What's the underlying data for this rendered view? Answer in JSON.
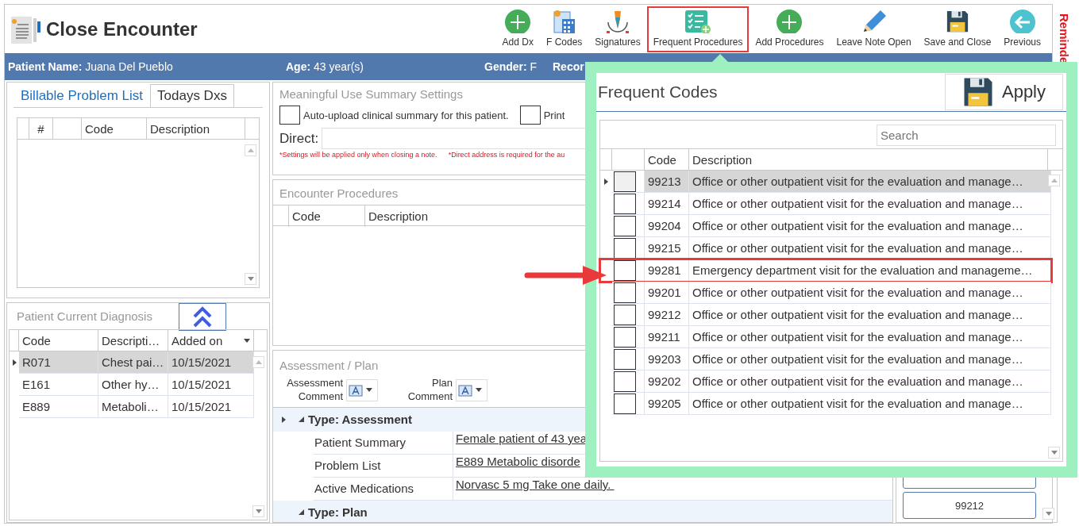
{
  "window": {
    "title": "Close Encounter",
    "side_tab": "Reminde"
  },
  "toolbar": [
    {
      "label": "Add Dx",
      "kind": "plus",
      "highlighted": false
    },
    {
      "label": "F Codes",
      "kind": "calculator",
      "highlighted": false
    },
    {
      "label": "Signatures",
      "kind": "pen",
      "highlighted": false
    },
    {
      "label": "Frequent Procedures",
      "kind": "checklist",
      "highlighted": true
    },
    {
      "label": "Add Procedures",
      "kind": "plus",
      "highlighted": false
    },
    {
      "label": "Leave Note Open",
      "kind": "pencil",
      "highlighted": false
    },
    {
      "label": "Save and Close",
      "kind": "floppy",
      "highlighted": false
    },
    {
      "label": "Previous",
      "kind": "back",
      "highlighted": false
    }
  ],
  "patient_bar": [
    {
      "label": "Patient Name:",
      "value": "Juana Del Pueblo"
    },
    {
      "label": "Age:",
      "value": "43 year(s)"
    },
    {
      "label": "Gender:",
      "value": "F"
    },
    {
      "label": "Recor"
    }
  ],
  "problem_tabs": [
    {
      "label": "Billable Problem List",
      "selected": true
    },
    {
      "label": "Todays Dxs",
      "selected": false
    }
  ],
  "problem_grid": {
    "columns": [
      "#",
      "Code",
      "Description"
    ]
  },
  "current_diagnosis": {
    "title": "Patient Current Diagnosis",
    "columns": [
      "Code",
      "Descripti…",
      "Added on"
    ],
    "rows": [
      {
        "code": "R071",
        "description": "Chest pai…",
        "added_on": "10/15/2021",
        "selected": true
      },
      {
        "code": "E161",
        "description": "Other hy…",
        "added_on": "10/15/2021",
        "selected": false
      },
      {
        "code": "E889",
        "description": "Metaboli…",
        "added_on": "10/15/2021",
        "selected": false
      }
    ]
  },
  "meaningful_use": {
    "title": "Meaningful Use Summary Settings",
    "options": [
      {
        "label": "Auto-upload clinical summary for this patient.",
        "checked": false
      },
      {
        "label": "Print",
        "checked": false
      }
    ],
    "direct_label": "Direct:",
    "notes": [
      "*Settings will be applied only when closing a note.",
      "*Direct address is required for the au"
    ]
  },
  "encounter_procedures": {
    "title": "Encounter Procedures",
    "columns": [
      "Code",
      "Description"
    ]
  },
  "assessment_plan": {
    "title": "Assessment / Plan",
    "comment_buttons": [
      "Assessment Comment",
      "Plan Comment"
    ],
    "groups": [
      {
        "label": "Type: Assessment",
        "expanded": true,
        "rows": [
          {
            "label": "Patient Summary",
            "value": "Female patient of 43 yea"
          },
          {
            "label": "Problem List",
            "value": "E889 Metabolic disorde"
          },
          {
            "label": "Active Medications",
            "value": "Norvasc 5 mg Take one daily. "
          }
        ]
      },
      {
        "label": "Type: Plan",
        "expanded": true
      }
    ]
  },
  "code_buttons": [
    "99212"
  ],
  "frequent_codes": {
    "title": "Frequent Codes",
    "apply": "Apply",
    "search": {
      "placeholder": "Search"
    },
    "columns": [
      "Code",
      "Description"
    ],
    "rows": [
      {
        "code": "99213",
        "description": "Office or other outpatient visit for the evaluation and manage…",
        "checked": false,
        "selected": true,
        "highlighted": false
      },
      {
        "code": "99214",
        "description": "Office or other outpatient visit for the evaluation and manage…",
        "checked": false,
        "selected": false,
        "highlighted": false
      },
      {
        "code": "99204",
        "description": "Office or other outpatient visit for the evaluation and manage…",
        "checked": false,
        "selected": false,
        "highlighted": false
      },
      {
        "code": "99215",
        "description": "Office or other outpatient visit for the evaluation and manage…",
        "checked": false,
        "selected": false,
        "highlighted": false
      },
      {
        "code": "99281",
        "description": "Emergency department visit for the evaluation and manageme…",
        "checked": false,
        "selected": false,
        "highlighted": true
      },
      {
        "code": "99201",
        "description": "Office or other outpatient visit for the evaluation and manage…",
        "checked": false,
        "selected": false,
        "highlighted": false
      },
      {
        "code": "99212",
        "description": "Office or other outpatient visit for the evaluation and manage…",
        "checked": false,
        "selected": false,
        "highlighted": false
      },
      {
        "code": "99211",
        "description": "Office or other outpatient visit for the evaluation and manage…",
        "checked": false,
        "selected": false,
        "highlighted": false
      },
      {
        "code": "99203",
        "description": "Office or other outpatient visit for the evaluation and manage…",
        "checked": false,
        "selected": false,
        "highlighted": false
      },
      {
        "code": "99202",
        "description": "Office or other outpatient visit for the evaluation and manage…",
        "checked": false,
        "selected": false,
        "highlighted": false
      },
      {
        "code": "99205",
        "description": "Office or other outpatient visit for the evaluation and manage…",
        "checked": false,
        "selected": false,
        "highlighted": false
      }
    ]
  }
}
